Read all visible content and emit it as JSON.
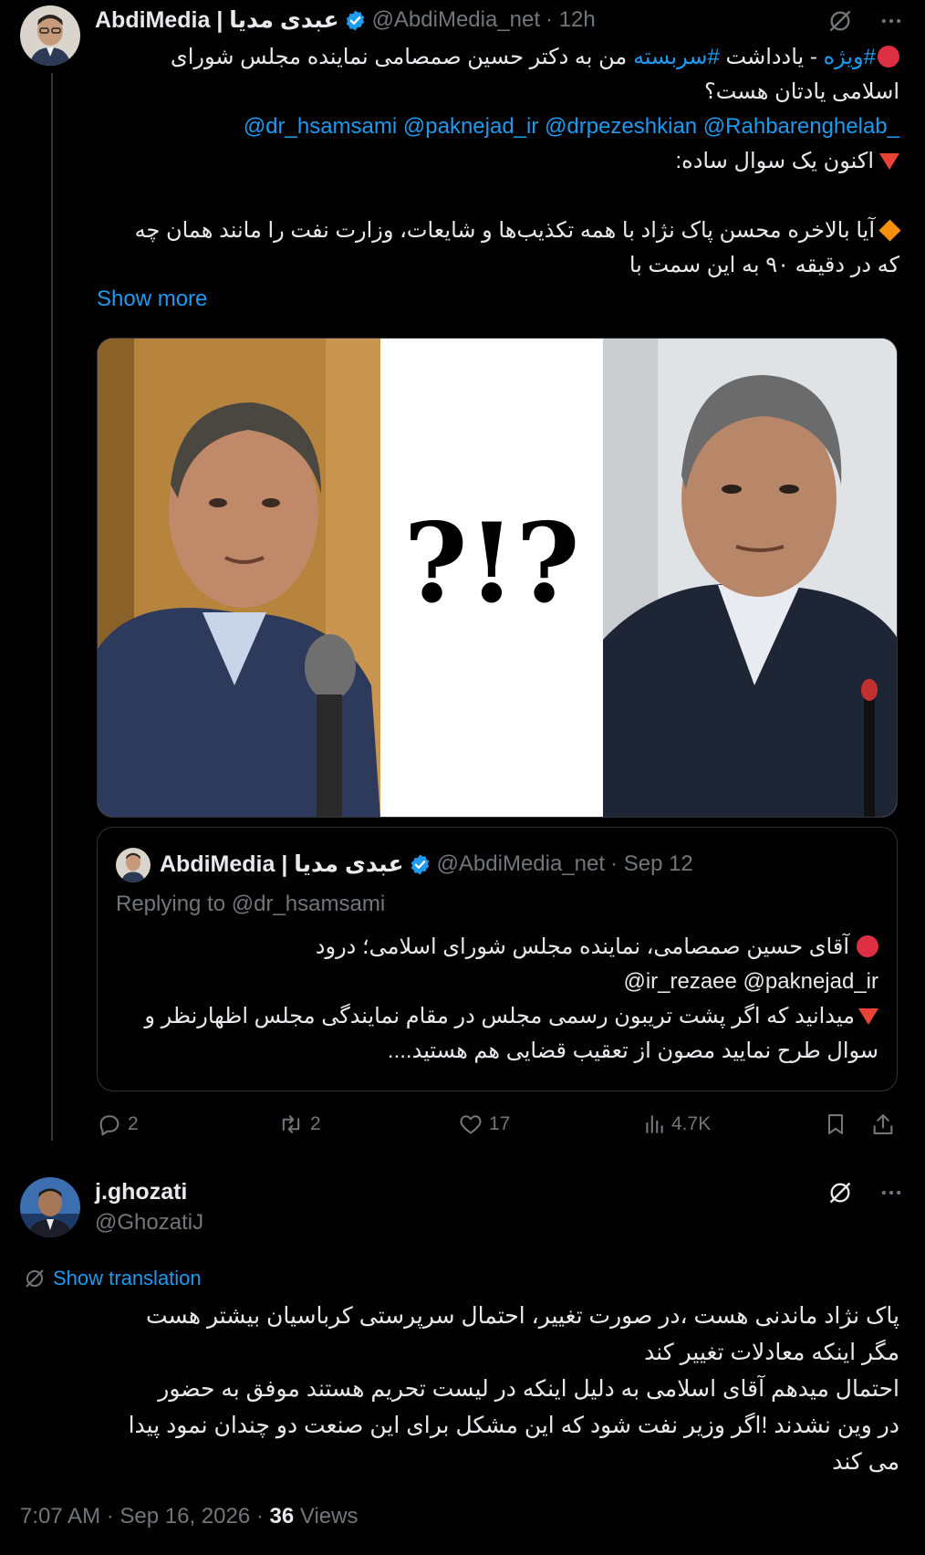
{
  "tweet": {
    "display_name": "AbdiMedia | عبدی مدیا",
    "handle": "@AbdiMedia_net",
    "time": "· 12h",
    "text_line1_hashtag1": "#ویژه",
    "text_line1_mid": " - یادداشت ",
    "text_line1_hashtag2": "#سربسته",
    "text_line1_rest": " من به دکتر حسین صمصامی نماینده مجلس شورای",
    "text_line2": "اسلامی یادتان هست؟",
    "mentions": "@dr_hsamsami @paknejad_ir @drpezeshkian @Rahbarenghelab_",
    "text_line3": "اکنون یک سوال ساده:",
    "text_line4": "آیا بالاخره محسن پاک نژاد با همه تکذیب‌ها و شایعات، وزارت نفت را مانند همان چه",
    "text_line5": "که در دقیقه ۹۰ به این سمت با",
    "show_more": "Show more",
    "stats": {
      "replies": "2",
      "reposts": "2",
      "likes": "17",
      "views": "4.7K"
    }
  },
  "quote": {
    "display_name": "AbdiMedia | عبدی مدیا",
    "handle": "@AbdiMedia_net",
    "time": "· Sep 12",
    "replying_to": "Replying to @dr_hsamsami",
    "line1": "آقای حسین صمصامی، نماینده مجلس شورای اسلامی؛ درود",
    "line2": "@ir_rezaee @paknejad_ir",
    "line3": "میدانید که اگر پشت تریبون رسمی مجلس در مقام نمایندگی مجلس اظهارنظر و",
    "line4": "سوال طرح نمایید مصون از تعقیب قضایی هم هستید...."
  },
  "reply": {
    "display_name": "j.ghozati",
    "handle": "@GhozatiJ",
    "show_translation": "Show translation",
    "line1": "پاک نژاد ماندنی هست ،در صورت تغییر، احتمال  سرپرستی کرباسیان بیشتر هست",
    "line2": "مگر اینکه معادلات تغییر کند",
    "line3": "احتمال میدهم آقای اسلامی به دلیل اینکه در لیست تحریم   هستند موفق به حضور",
    "line4": "در وین نشدند !اگر وزیر نفت شود که این مشکل  برای این صنعت دو چندان نمود پیدا",
    "line5": "می کند"
  },
  "footer": {
    "timestamp": "7:07 AM · Sep 16, 2026 · ",
    "views_count": "36",
    "views_label": " Views"
  },
  "colors": {
    "accent": "#1d9bf0",
    "muted": "#71767b",
    "text": "#e7e9ea",
    "border": "#2f3336"
  }
}
